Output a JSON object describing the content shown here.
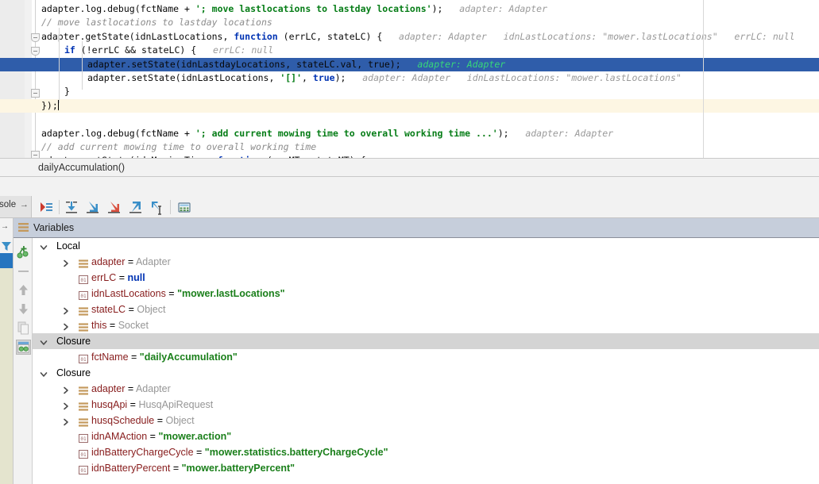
{
  "editor": {
    "lines": [
      {
        "indent": 0,
        "segments": [
          {
            "t": "adapter.log.debug(fctName + ",
            "c": "pln"
          },
          {
            "t": "'; move lastlocations to lastday locations'",
            "c": "str"
          },
          {
            "t": ");",
            "c": "pln"
          },
          {
            "t": "   adapter: Adapter",
            "c": "inl"
          }
        ]
      },
      {
        "indent": 0,
        "segments": [
          {
            "t": "// move lastlocations to lastday locations",
            "c": "cmt"
          }
        ]
      },
      {
        "indent": 0,
        "segments": [
          {
            "t": "adapter.getState(idnLastLocations, ",
            "c": "pln"
          },
          {
            "t": "function",
            "c": "kw"
          },
          {
            "t": " (errLC, stateLC) {",
            "c": "pln"
          },
          {
            "t": "   adapter: Adapter   idnLastLocations: \"mower.lastLocations\"   errLC: null",
            "c": "inl"
          }
        ]
      },
      {
        "indent": 1,
        "segments": [
          {
            "t": "if",
            "c": "kw"
          },
          {
            "t": " (!errLC && stateLC) {",
            "c": "pln"
          },
          {
            "t": "   errLC: null",
            "c": "inl"
          }
        ]
      },
      {
        "indent": 2,
        "selected": true,
        "segments": [
          {
            "t": "adapter.setState(idnLastdayLocations, stateLC.val, true);",
            "c": "pln"
          },
          {
            "t": "   adapter: Adapter",
            "c": "inl-sel"
          }
        ]
      },
      {
        "indent": 2,
        "segments": [
          {
            "t": "adapter.setState(idnLastLocations, ",
            "c": "pln"
          },
          {
            "t": "'[]'",
            "c": "str"
          },
          {
            "t": ", ",
            "c": "pln"
          },
          {
            "t": "true",
            "c": "kw"
          },
          {
            "t": ");",
            "c": "pln"
          },
          {
            "t": "   adapter: Adapter   idnLastLocations: \"mower.lastLocations\"",
            "c": "inl"
          }
        ]
      },
      {
        "indent": 1,
        "segments": [
          {
            "t": "}",
            "c": "pln"
          }
        ]
      },
      {
        "indent": 0,
        "caretline": true,
        "caret": true,
        "segments": [
          {
            "t": "});",
            "c": "pln"
          }
        ]
      },
      {
        "indent": 0,
        "segments": []
      },
      {
        "indent": 0,
        "segments": [
          {
            "t": "adapter.log.debug(fctName + ",
            "c": "pln"
          },
          {
            "t": "'; add current mowing time to overall working time ...'",
            "c": "str"
          },
          {
            "t": ");",
            "c": "pln"
          },
          {
            "t": "   adapter: Adapter",
            "c": "inl"
          }
        ]
      },
      {
        "indent": 0,
        "segments": [
          {
            "t": "// add current mowing time to overall working time",
            "c": "cmt"
          }
        ]
      },
      {
        "indent": 0,
        "clipped": true,
        "segments": [
          {
            "t": "adapter.getState(idnMowingTime, ",
            "c": "pln"
          },
          {
            "t": "function",
            "c": "kw"
          },
          {
            "t": " (errMT, stateMT) {",
            "c": "pln"
          }
        ]
      }
    ]
  },
  "breadcrumb": {
    "path": "dailyAccumulation()"
  },
  "debug_toolbar": {
    "console_tab_label": "sole",
    "console_tab_arrow": "→",
    "buttons": [
      {
        "name": "show-execution-point-button",
        "tooltip": "Show Execution Point"
      },
      {
        "name": "step-over-button",
        "tooltip": "Step Over"
      },
      {
        "name": "step-into-button",
        "tooltip": "Step Into"
      },
      {
        "name": "force-step-into-button",
        "tooltip": "Force Step Into"
      },
      {
        "name": "step-out-button",
        "tooltip": "Step Out"
      },
      {
        "name": "run-to-cursor-button",
        "tooltip": "Run to Cursor"
      },
      {
        "name": "evaluate-expression-button",
        "tooltip": "Evaluate Expression"
      }
    ]
  },
  "variables_panel": {
    "title": "Variables",
    "side_tools": [
      {
        "name": "new-watch-button",
        "tooltip": "New Watch"
      },
      {
        "name": "remove-watch-button",
        "tooltip": "Remove Watch"
      },
      {
        "name": "move-watch-up-button",
        "tooltip": "Move Watch Up"
      },
      {
        "name": "move-watch-down-button",
        "tooltip": "Move Watch Down"
      },
      {
        "name": "copy-value-button",
        "tooltip": "Copy Value"
      },
      {
        "name": "inspect-button",
        "tooltip": "Inspect",
        "pressed": true
      }
    ],
    "rows": [
      {
        "kind": "group",
        "depth": 0,
        "expanded": true,
        "label": "Local"
      },
      {
        "kind": "var",
        "depth": 1,
        "chevron": true,
        "icon": "object",
        "name": "adapter",
        "value": "Adapter",
        "value_type": "object"
      },
      {
        "kind": "var",
        "depth": 1,
        "chevron": false,
        "icon": "primitive",
        "name": "errLC",
        "value": "null",
        "value_type": "null"
      },
      {
        "kind": "var",
        "depth": 1,
        "chevron": false,
        "icon": "primitive",
        "name": "idnLastLocations",
        "value": "\"mower.lastLocations\"",
        "value_type": "string"
      },
      {
        "kind": "var",
        "depth": 1,
        "chevron": true,
        "icon": "object",
        "name": "stateLC",
        "value": "Object",
        "value_type": "object"
      },
      {
        "kind": "var",
        "depth": 1,
        "chevron": true,
        "icon": "object",
        "name": "this",
        "value": "Socket",
        "value_type": "object"
      },
      {
        "kind": "group",
        "depth": 0,
        "expanded": true,
        "label": "Closure",
        "banded": true
      },
      {
        "kind": "var",
        "depth": 1,
        "chevron": false,
        "icon": "primitive",
        "name": "fctName",
        "value": "\"dailyAccumulation\"",
        "value_type": "string"
      },
      {
        "kind": "group",
        "depth": 0,
        "expanded": true,
        "label": "Closure"
      },
      {
        "kind": "var",
        "depth": 1,
        "chevron": true,
        "icon": "object",
        "name": "adapter",
        "value": "Adapter",
        "value_type": "object"
      },
      {
        "kind": "var",
        "depth": 1,
        "chevron": true,
        "icon": "object",
        "name": "husqApi",
        "value": "HusqApiRequest",
        "value_type": "object"
      },
      {
        "kind": "var",
        "depth": 1,
        "chevron": true,
        "icon": "object",
        "name": "husqSchedule",
        "value": "Object",
        "value_type": "object"
      },
      {
        "kind": "var",
        "depth": 1,
        "chevron": false,
        "icon": "primitive",
        "name": "idnAMAction",
        "value": "\"mower.action\"",
        "value_type": "string"
      },
      {
        "kind": "var",
        "depth": 1,
        "chevron": false,
        "icon": "primitive",
        "name": "idnBatteryChargeCycle",
        "value": "\"mower.statistics.batteryChargeCycle\"",
        "value_type": "string"
      },
      {
        "kind": "var",
        "depth": 1,
        "chevron": false,
        "icon": "primitive",
        "name": "idnBatteryPercent",
        "value": "\"mower.batteryPercent\"",
        "value_type": "string"
      }
    ]
  },
  "colors": {
    "selected_line": "#2f5daa",
    "caret_line": "#fdf6e3",
    "panel_header": "#c6cedb",
    "string_green": "#067d17",
    "keyword_blue": "#0033b3",
    "variable_name": "#871c1c",
    "breakpoint_red": "#db5860"
  }
}
